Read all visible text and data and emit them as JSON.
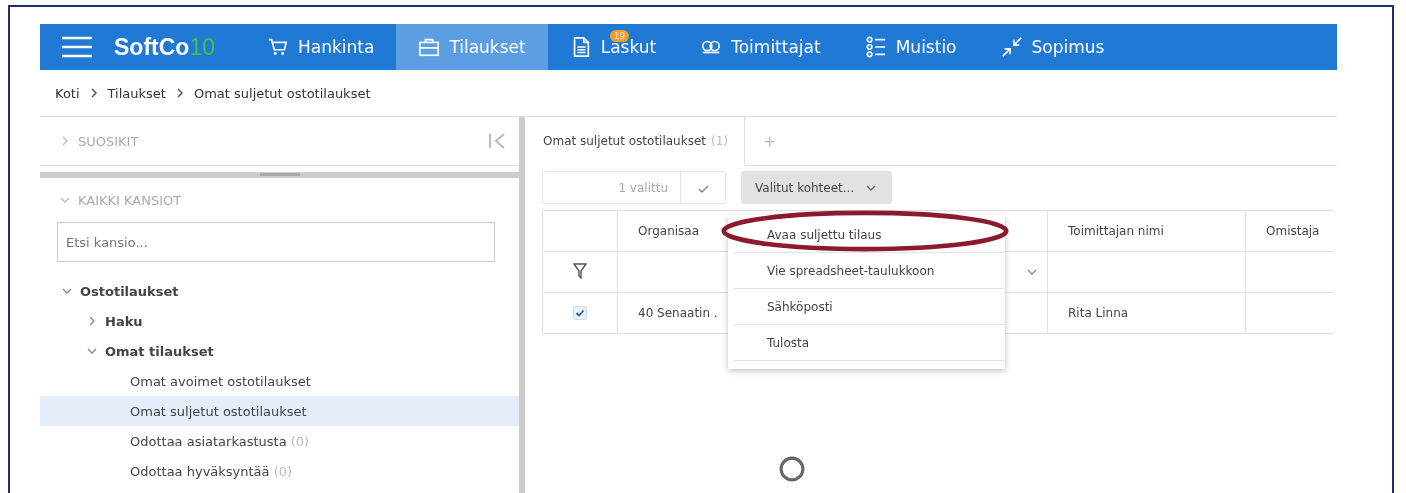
{
  "nav": {
    "logo": {
      "text": "SoftCo",
      "version": "10"
    },
    "items": [
      {
        "label": "Hankinta",
        "kind": "cart",
        "selected": false
      },
      {
        "label": "Tilaukset",
        "kind": "briefcase",
        "selected": true
      },
      {
        "label": "Laskut",
        "kind": "document",
        "selected": false,
        "badge": "19"
      },
      {
        "label": "Toimittajat",
        "kind": "people",
        "selected": false
      },
      {
        "label": "Muistio",
        "kind": "list",
        "selected": false
      },
      {
        "label": "Sopimus",
        "kind": "compress",
        "selected": false
      }
    ]
  },
  "breadcrumb": [
    "Koti",
    "Tilaukset",
    "Omat suljetut ostotilaukset"
  ],
  "sidebar": {
    "favorites": {
      "label": "SUOSIKIT",
      "expanded": false
    },
    "folders": {
      "label": "KAIKKI KANSIOT",
      "expanded": true
    },
    "search": {
      "placeholder": "Etsi kansio..."
    },
    "tree": [
      {
        "label": "Ostotilaukset",
        "expanded": true,
        "selected": false,
        "children": [
          {
            "label": "Haku",
            "expanded": false,
            "selected": false
          },
          {
            "label": "Omat tilaukset",
            "expanded": true,
            "selected": false,
            "children": [
              {
                "label": "Omat avoimet ostotilaukset",
                "selected": false
              },
              {
                "label": "Omat suljetut ostotilaukset",
                "selected": true
              },
              {
                "label": "Odottaa asiatarkastusta",
                "count": "(0)",
                "selected": false
              },
              {
                "label": "Odottaa hyväksyntää",
                "count": "(0)",
                "selected": false
              }
            ]
          }
        ]
      }
    ]
  },
  "main": {
    "tabs": [
      {
        "label": "Omat suljetut ostotilaukset",
        "count": "(1)",
        "selected": true
      }
    ],
    "add_tab": "+",
    "selection_count": "1 valittu",
    "action_button": "Valitut kohteet...",
    "table": {
      "columns": [
        "",
        "Organisaa",
        "",
        "Toimittajan nimi",
        "Omistaja"
      ],
      "rows": [
        {
          "checked": true,
          "cells": [
            "40 Senaatin .",
            "",
            "Rita Linna",
            ""
          ]
        }
      ]
    },
    "menu": {
      "items": [
        {
          "label": "Avaa suljettu tilaus",
          "highlighted": true
        },
        {
          "label": "Vie spreadsheet-taulukkoon",
          "highlighted": false
        },
        {
          "label": "Sähköposti",
          "highlighted": false
        },
        {
          "label": "Tulosta",
          "highlighted": false
        }
      ]
    },
    "loading": true
  }
}
